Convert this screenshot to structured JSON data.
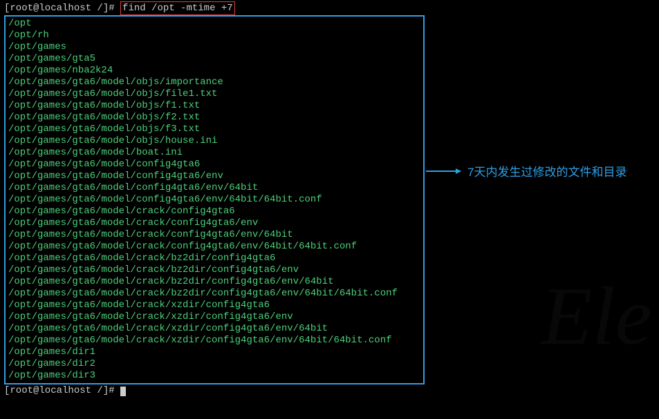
{
  "prompt": {
    "prefix": "[root@localhost /]#",
    "command": "find /opt -mtime +7"
  },
  "output": [
    "/opt",
    "/opt/rh",
    "/opt/games",
    "/opt/games/gta5",
    "/opt/games/nba2k24",
    "/opt/games/gta6/model/objs/importance",
    "/opt/games/gta6/model/objs/file1.txt",
    "/opt/games/gta6/model/objs/f1.txt",
    "/opt/games/gta6/model/objs/f2.txt",
    "/opt/games/gta6/model/objs/f3.txt",
    "/opt/games/gta6/model/objs/house.ini",
    "/opt/games/gta6/model/boat.ini",
    "/opt/games/gta6/model/config4gta6",
    "/opt/games/gta6/model/config4gta6/env",
    "/opt/games/gta6/model/config4gta6/env/64bit",
    "/opt/games/gta6/model/config4gta6/env/64bit/64bit.conf",
    "/opt/games/gta6/model/crack/config4gta6",
    "/opt/games/gta6/model/crack/config4gta6/env",
    "/opt/games/gta6/model/crack/config4gta6/env/64bit",
    "/opt/games/gta6/model/crack/config4gta6/env/64bit/64bit.conf",
    "/opt/games/gta6/model/crack/bz2dir/config4gta6",
    "/opt/games/gta6/model/crack/bz2dir/config4gta6/env",
    "/opt/games/gta6/model/crack/bz2dir/config4gta6/env/64bit",
    "/opt/games/gta6/model/crack/bz2dir/config4gta6/env/64bit/64bit.conf",
    "/opt/games/gta6/model/crack/xzdir/config4gta6",
    "/opt/games/gta6/model/crack/xzdir/config4gta6/env",
    "/opt/games/gta6/model/crack/xzdir/config4gta6/env/64bit",
    "/opt/games/gta6/model/crack/xzdir/config4gta6/env/64bit/64bit.conf",
    "/opt/games/dir1",
    "/opt/games/dir2",
    "/opt/games/dir3"
  ],
  "prompt2": {
    "prefix": "[root@localhost /]#"
  },
  "annotation": "7天内发生过修改的文件和目录",
  "watermark": "Ele"
}
